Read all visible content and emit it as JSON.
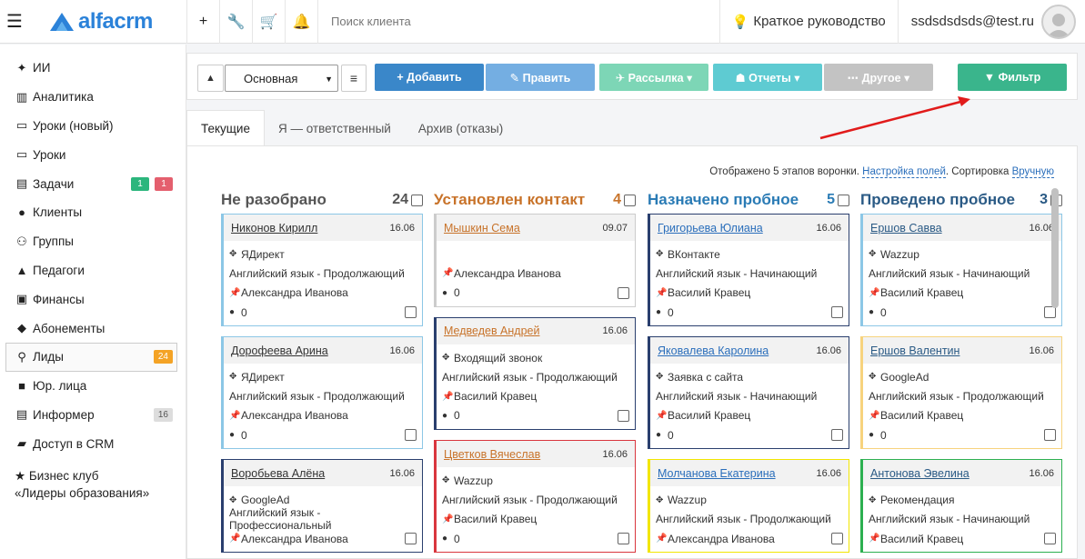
{
  "topbar": {
    "logo_text": "alfacrm",
    "search_placeholder": "Поиск клиента",
    "guide_label": "Краткое руководство",
    "user_email": "ssdsdsdsds@test.ru"
  },
  "sidebar": {
    "items": [
      {
        "label": "ИИ",
        "icon": "sparkle-icon"
      },
      {
        "label": "Аналитика",
        "icon": "columns-icon"
      },
      {
        "label": "Уроки (новый)",
        "icon": "calendar-icon"
      },
      {
        "label": "Уроки",
        "icon": "calendar-icon"
      },
      {
        "label": "Задачи",
        "icon": "clipboard-icon",
        "badge1": "1",
        "badge2": "1"
      },
      {
        "label": "Клиенты",
        "icon": "user-icon"
      },
      {
        "label": "Группы",
        "icon": "users-icon"
      },
      {
        "label": "Педагоги",
        "icon": "graduation-cap-icon"
      },
      {
        "label": "Финансы",
        "icon": "money-icon"
      },
      {
        "label": "Абонементы",
        "icon": "tag-icon"
      },
      {
        "label": "Лиды",
        "icon": "funnel-icon",
        "badge": "24"
      },
      {
        "label": "Юр. лица",
        "icon": "briefcase-icon"
      },
      {
        "label": "Информер",
        "icon": "calendar-icon",
        "badge": "16"
      },
      {
        "label": "Доступ в CRM",
        "icon": "lock-icon"
      }
    ],
    "club_line1": "Бизнес клуб",
    "club_line2": "«Лидеры образования»"
  },
  "toolbar": {
    "select_value": "Основная",
    "add": "+ Добавить",
    "edit": "✎ Править",
    "mail": "✈ Рассылка ▾",
    "reports": "☗ Отчеты ▾",
    "other": "⋯ Другое ▾",
    "filter": "▼ Фильтр"
  },
  "tabs": [
    "Текущие",
    "Я — ответственный",
    "Архив (отказы)"
  ],
  "board": {
    "info_text": "Отображено 5 этапов воронки.",
    "fields_link": "Настройка полей",
    "sort_text": ". Сортировка",
    "sort_link": "Вручную"
  },
  "columns": [
    {
      "title": "Не разобрано",
      "count": "24",
      "color": "#555555",
      "cards": [
        {
          "name": "Никонов Кирилл",
          "date": "16.06",
          "border": "#8cc7e6",
          "name_color": "#333333",
          "rows": [
            "ЯДирект",
            "Английский язык - Продолжающий",
            "Александра Иванова",
            "0"
          ]
        },
        {
          "name": "Дорофеева Арина",
          "date": "16.06",
          "border": "#8cc7e6",
          "name_color": "#333333",
          "rows": [
            "ЯДирект",
            "Английский язык - Продолжающий",
            "Александра Иванова",
            "0"
          ]
        },
        {
          "name": "Воробьева Алёна",
          "date": "16.06",
          "border": "#2a3f6e",
          "name_color": "#333333",
          "rows": [
            "GoogleAd",
            "Английский язык - Профессиональный",
            "Александра Иванова"
          ]
        }
      ]
    },
    {
      "title": "Установлен контакт",
      "count": "4",
      "color": "#c8732a",
      "cards": [
        {
          "name": "Мышкин Сема",
          "date": "09.07",
          "border": "#cccccc",
          "name_color": "#c8732a",
          "rows": [
            "",
            "Александра Иванова",
            "0"
          ]
        },
        {
          "name": "Медведев Андрей",
          "date": "16.06",
          "border": "#2a3f6e",
          "name_color": "#c8732a",
          "rows": [
            "Входящий звонок",
            "Английский язык - Продолжающий",
            "Василий Кравец",
            "0"
          ]
        },
        {
          "name": "Цветков Вячеслав",
          "date": "16.06",
          "border": "#d9363e",
          "name_color": "#c8732a",
          "rows": [
            "Wazzup",
            "Английский язык - Продолжающий",
            "Василий Кравец",
            "0"
          ]
        }
      ]
    },
    {
      "title": "Назначено пробное",
      "count": "5",
      "color": "#2a7bb5",
      "cards": [
        {
          "name": "Григорьева Юлиана",
          "date": "16.06",
          "border": "#2a3f6e",
          "name_color": "#2a6ebb",
          "rows": [
            "ВКонтакте",
            "Английский язык - Начинающий",
            "Василий Кравец",
            "0"
          ]
        },
        {
          "name": "Яковалева Каролина",
          "date": "16.06",
          "border": "#2a3f6e",
          "name_color": "#2a6ebb",
          "rows": [
            "Заявка с сайта",
            "Английский язык - Начинающий",
            "Василий Кравец",
            "0"
          ]
        },
        {
          "name": "Молчанова Екатерина",
          "date": "16.06",
          "border": "#f2e600",
          "name_color": "#2a6ebb",
          "rows": [
            "Wazzup",
            "Английский язык - Продолжающий",
            "Александра Иванова"
          ]
        }
      ]
    },
    {
      "title": "Проведено пробное",
      "count": "3",
      "color": "#2a5a85",
      "cards": [
        {
          "name": "Ершов Савва",
          "date": "16.06",
          "border": "#8cc7e6",
          "name_color": "#2a5a85",
          "rows": [
            "Wazzup",
            "Английский язык - Начинающий",
            "Василий Кравец",
            "0"
          ]
        },
        {
          "name": "Ершов Валентин",
          "date": "16.06",
          "border": "#f7d37d",
          "name_color": "#2a5a85",
          "rows": [
            "GoogleAd",
            "Английский язык - Продолжающий",
            "Василий Кравец",
            "0"
          ]
        },
        {
          "name": "Антонова Эвелина",
          "date": "16.06",
          "border": "#2cb050",
          "name_color": "#2a5a85",
          "rows": [
            "Рекомендация",
            "Английский язык - Начинающий",
            "Василий Кравец"
          ]
        }
      ]
    }
  ]
}
